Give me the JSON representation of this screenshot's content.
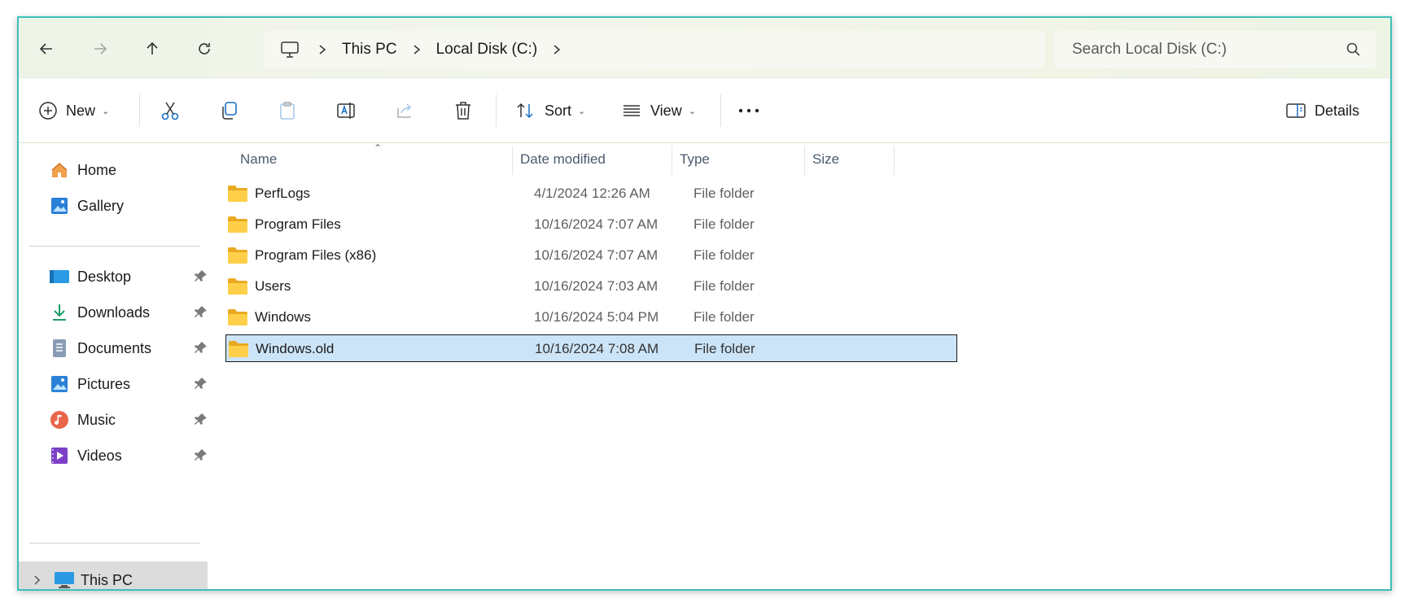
{
  "address_bar": {
    "back_icon": "back-arrow-icon",
    "forward_icon": "forward-arrow-icon",
    "up_icon": "up-arrow-icon",
    "refresh_icon": "refresh-icon",
    "breadcrumb": [
      "This PC",
      "Local Disk (C:)"
    ],
    "search_placeholder": "Search Local Disk (C:)"
  },
  "toolbar": {
    "new_label": "New",
    "sort_label": "Sort",
    "view_label": "View",
    "details_label": "Details"
  },
  "sidebar": {
    "top_items": [
      {
        "label": "Home",
        "icon": "home-icon"
      },
      {
        "label": "Gallery",
        "icon": "gallery-icon"
      }
    ],
    "pinned_items": [
      {
        "label": "Desktop",
        "icon": "desktop-icon"
      },
      {
        "label": "Downloads",
        "icon": "downloads-icon"
      },
      {
        "label": "Documents",
        "icon": "documents-icon"
      },
      {
        "label": "Pictures",
        "icon": "pictures-icon"
      },
      {
        "label": "Music",
        "icon": "music-icon"
      },
      {
        "label": "Videos",
        "icon": "videos-icon"
      }
    ],
    "this_pc_label": "This PC"
  },
  "columns": {
    "name": "Name",
    "date_modified": "Date modified",
    "type": "Type",
    "size": "Size"
  },
  "files": [
    {
      "name": "PerfLogs",
      "date": "4/1/2024 12:26 AM",
      "type": "File folder",
      "size": ""
    },
    {
      "name": "Program Files",
      "date": "10/16/2024 7:07 AM",
      "type": "File folder",
      "size": ""
    },
    {
      "name": "Program Files (x86)",
      "date": "10/16/2024 7:07 AM",
      "type": "File folder",
      "size": ""
    },
    {
      "name": "Users",
      "date": "10/16/2024 7:03 AM",
      "type": "File folder",
      "size": ""
    },
    {
      "name": "Windows",
      "date": "10/16/2024 5:04 PM",
      "type": "File folder",
      "size": ""
    },
    {
      "name": "Windows.old",
      "date": "10/16/2024 7:08 AM",
      "type": "File folder",
      "size": "",
      "selected": true
    }
  ],
  "colors": {
    "window_border": "#3cc0b8",
    "selection_bg": "#cce4f7",
    "folder_yellow": "#f5c342"
  }
}
